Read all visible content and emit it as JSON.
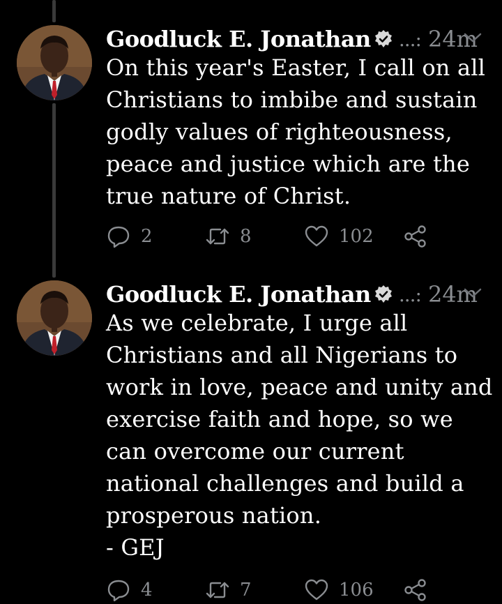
{
  "tweets": [
    {
      "name": "Goodluck E. Jonathan",
      "handle": "...:",
      "time": "24m",
      "text": "On this year's Easter, I call on all\nChristians to imbibe and sustain\ngodly values of righteousness,\npeace and justice which are the\ntrue nature of Christ.",
      "replies": "2",
      "retweets": "8",
      "likes": "102"
    },
    {
      "name": "Goodluck E. Jonathan",
      "handle": "...:",
      "time": "24m",
      "text": "As we celebrate, I urge all\nChristians and all Nigerians to\nwork in love, peace and unity and\nexercise faith and hope, so we\ncan overcome our current\nnational challenges and build a\nprosperous nation.\n- GEJ",
      "replies": "4",
      "retweets": "7",
      "likes": "106"
    }
  ],
  "icons": {
    "verified": "verified-badge-icon",
    "menu": "chevron-down-icon",
    "reply": "reply-icon",
    "retweet": "retweet-icon",
    "like": "heart-icon",
    "share": "share-icon"
  },
  "colors": {
    "background": "#000000",
    "text": "#ffffff",
    "muted": "#8a8d91"
  }
}
